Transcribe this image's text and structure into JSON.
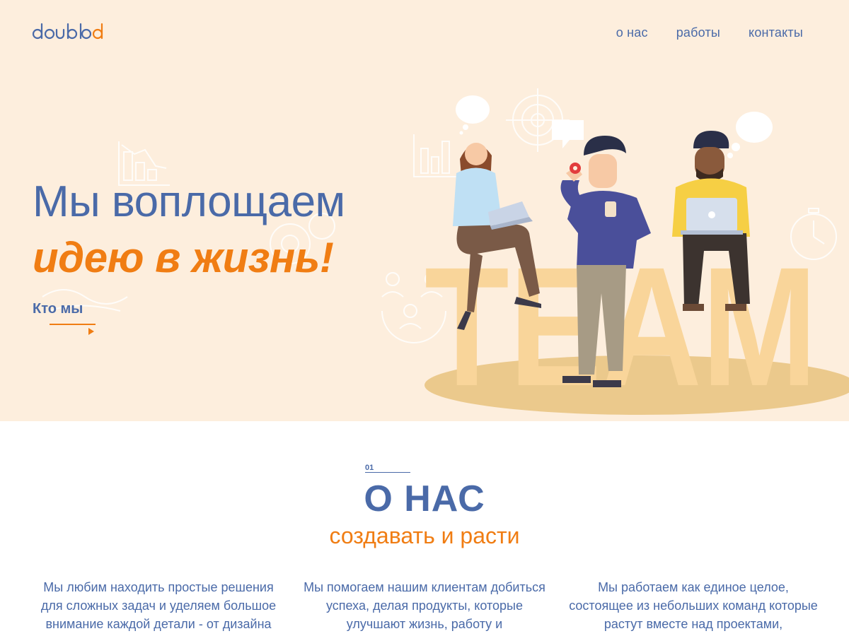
{
  "brand": {
    "logo_text": "doubled",
    "primary_color": "#4a6aa8",
    "accent_color": "#f07d13",
    "hero_bg": "#fdeedd"
  },
  "nav": {
    "items": [
      {
        "label": "о нас"
      },
      {
        "label": "работы"
      },
      {
        "label": "контакты"
      }
    ]
  },
  "hero": {
    "headline_line1": "Мы воплощаем",
    "headline_line2": "идею в жизнь!",
    "cta_label": "Кто мы",
    "illustration_word": "TEAM"
  },
  "about": {
    "number": "01",
    "title": "О НАС",
    "subtitle": "создавать и расти",
    "columns": [
      {
        "text": "Мы любим находить простые решения для сложных задач и уделяем большое внимание каждой детали - от дизайна"
      },
      {
        "text": "Мы помогаем нашим клиентам добиться успеха, делая продукты, которые улучшают жизнь, работу и"
      },
      {
        "text": "Мы работаем как единое целое, состоящее из небольших команд которые растут вместе над проектами,"
      }
    ]
  }
}
